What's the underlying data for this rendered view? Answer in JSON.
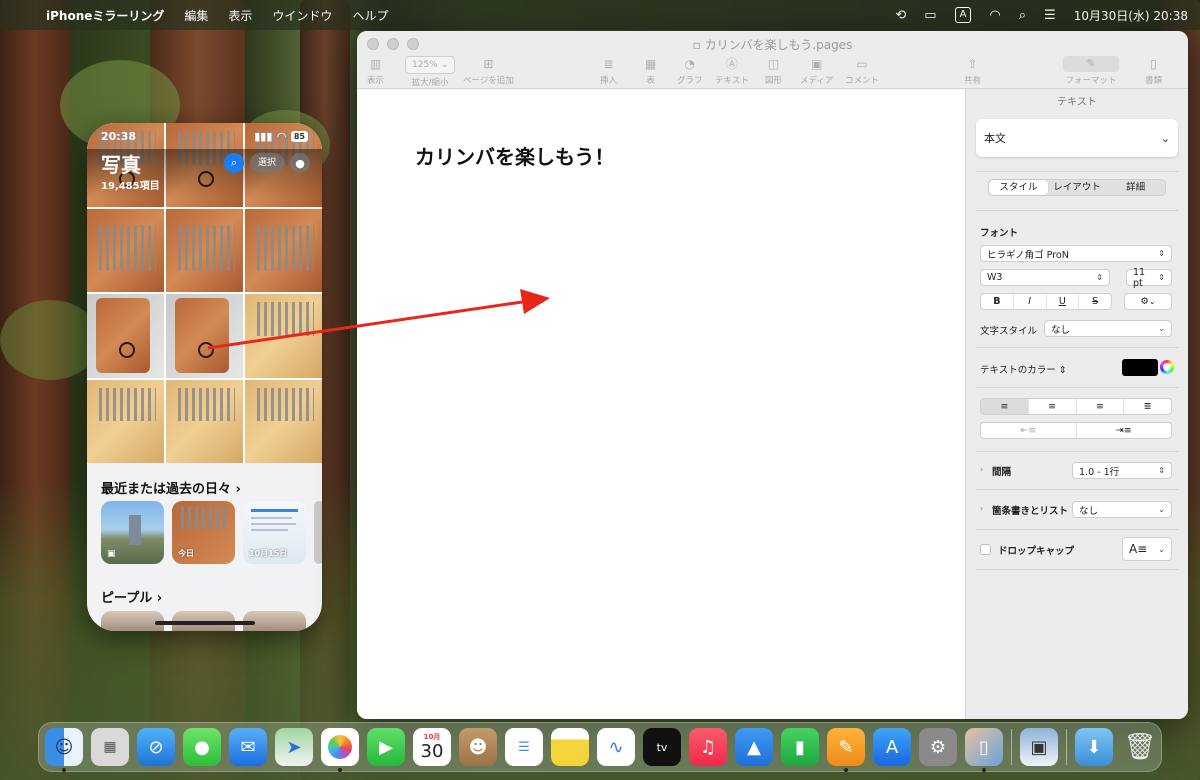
{
  "menubar": {
    "apple_icon": "apple-logo-icon",
    "app_name": "iPhoneミラーリング",
    "menus": [
      "編集",
      "表示",
      "ウインドウ",
      "ヘルプ"
    ],
    "input_source": "A",
    "datetime": "10月30日(水) 20:38"
  },
  "iphone": {
    "time": "20:38",
    "battery": "85",
    "title": "写真",
    "count": "19,485項目",
    "select_label": "選択",
    "memories_heading": "最近または過去の日々",
    "memories": [
      {
        "label": ""
      },
      {
        "label": "今日"
      },
      {
        "label": "10月15日"
      }
    ],
    "people_heading": "ピープル"
  },
  "pages": {
    "window_title": "カリンバを楽しもう.pages",
    "zoom": "125%",
    "toolbar": {
      "view": "表示",
      "zoom_label": "拡大/縮小",
      "add_page": "ページを追加",
      "insert": "挿入",
      "table": "表",
      "chart": "グラフ",
      "text": "テキスト",
      "shape": "図形",
      "media": "メディア",
      "comment": "コメント",
      "share": "共有",
      "format": "フォーマット",
      "document": "書類"
    },
    "heading": "カリンバを楽しもう！",
    "inspector": {
      "title": "テキスト",
      "paragraph_style": "本文",
      "tabs": [
        "スタイル",
        "レイアウト",
        "詳細"
      ],
      "font_label": "フォント",
      "font_family": "ヒラギノ角ゴ ProN",
      "font_weight": "W3",
      "font_size": "11 pt",
      "bold": "B",
      "italic": "I",
      "underline": "U",
      "strike": "S",
      "char_style_label": "文字スタイル",
      "char_style_value": "なし",
      "text_color_label": "テキストのカラー",
      "text_color": "#000000",
      "spacing_label": "間隔",
      "spacing_value": "1.0 - 1行",
      "bullets_label": "箇条書きとリスト",
      "bullets_value": "なし",
      "dropcap_label": "ドロップキャップ"
    }
  },
  "dock": {
    "calendar_month": "10月",
    "calendar_day": "30",
    "apps": [
      "Finder",
      "Launchpad",
      "Safari",
      "メッセージ",
      "メール",
      "マップ",
      "写真",
      "FaceTime",
      "カレンダー",
      "連絡先",
      "リマインダー",
      "メモ",
      "フリーボード",
      "TV",
      "ミュージック",
      "Keynote",
      "Numbers",
      "Pages",
      "App Store",
      "システム設定",
      "iPhoneミラーリング",
      "プレビュー",
      "ダウンロード",
      "ゴミ箱"
    ]
  },
  "colors": {
    "arrow": "#e8261c",
    "accent": "#1a7df2"
  }
}
